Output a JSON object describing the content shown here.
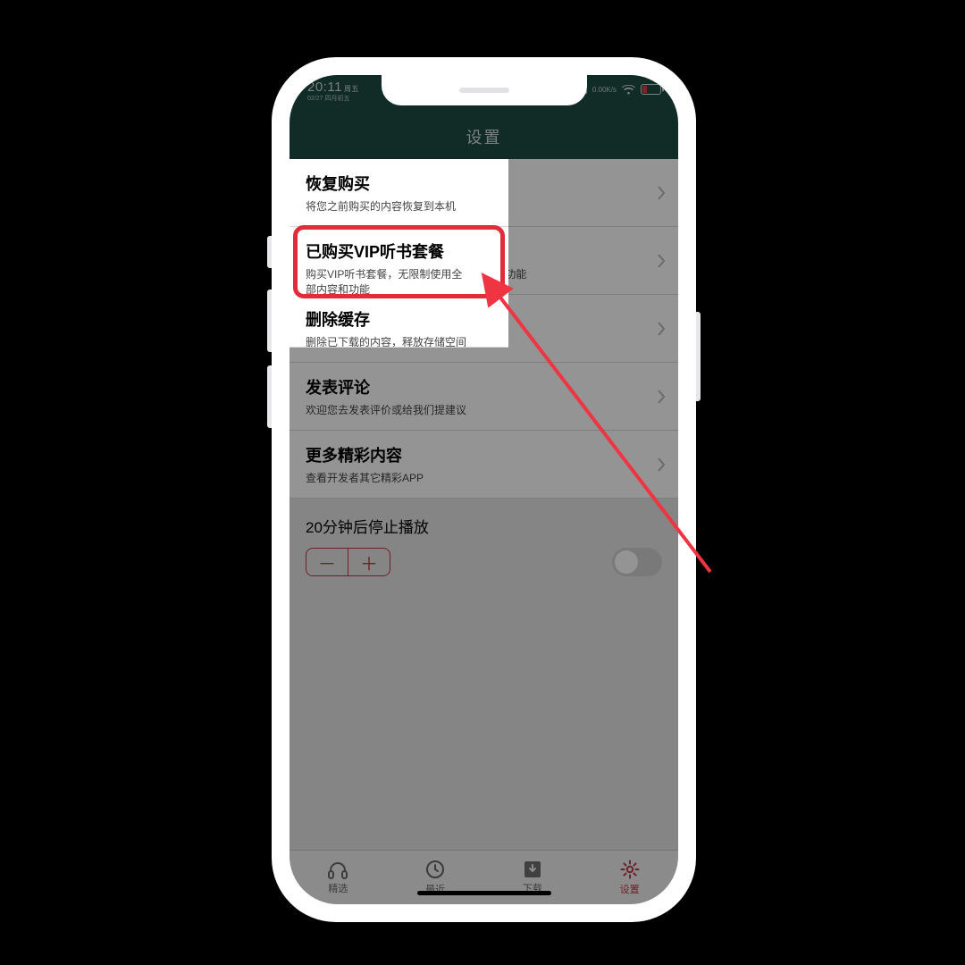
{
  "status": {
    "time": "20:11",
    "day_label": "周五",
    "sub_label": "02/27 四月初五",
    "net_speed": "0.00K/s"
  },
  "nav": {
    "title": "设置"
  },
  "rows": [
    {
      "title": "恢复购买",
      "sub": "将您之前购买的内容恢复到本机"
    },
    {
      "title": "已购买VIP听书套餐",
      "sub": "购买VIP听书套餐，无限制使用全部内容和功能"
    },
    {
      "title": "删除缓存",
      "sub": "删除已下载的内容，释放存储空间"
    },
    {
      "title": "发表评论",
      "sub": "欢迎您去发表评价或给我们提建议"
    },
    {
      "title": "更多精彩内容",
      "sub": "查看开发者其它精彩APP"
    }
  ],
  "timer": {
    "label": "20分钟后停止播放",
    "minus": "－",
    "plus": "＋",
    "on": false
  },
  "tabs": [
    {
      "id": "featured",
      "label": "精选"
    },
    {
      "id": "recent",
      "label": "最近"
    },
    {
      "id": "downloads",
      "label": "下载"
    },
    {
      "id": "settings",
      "label": "设置",
      "active": true
    }
  ],
  "accent": "#c23842"
}
